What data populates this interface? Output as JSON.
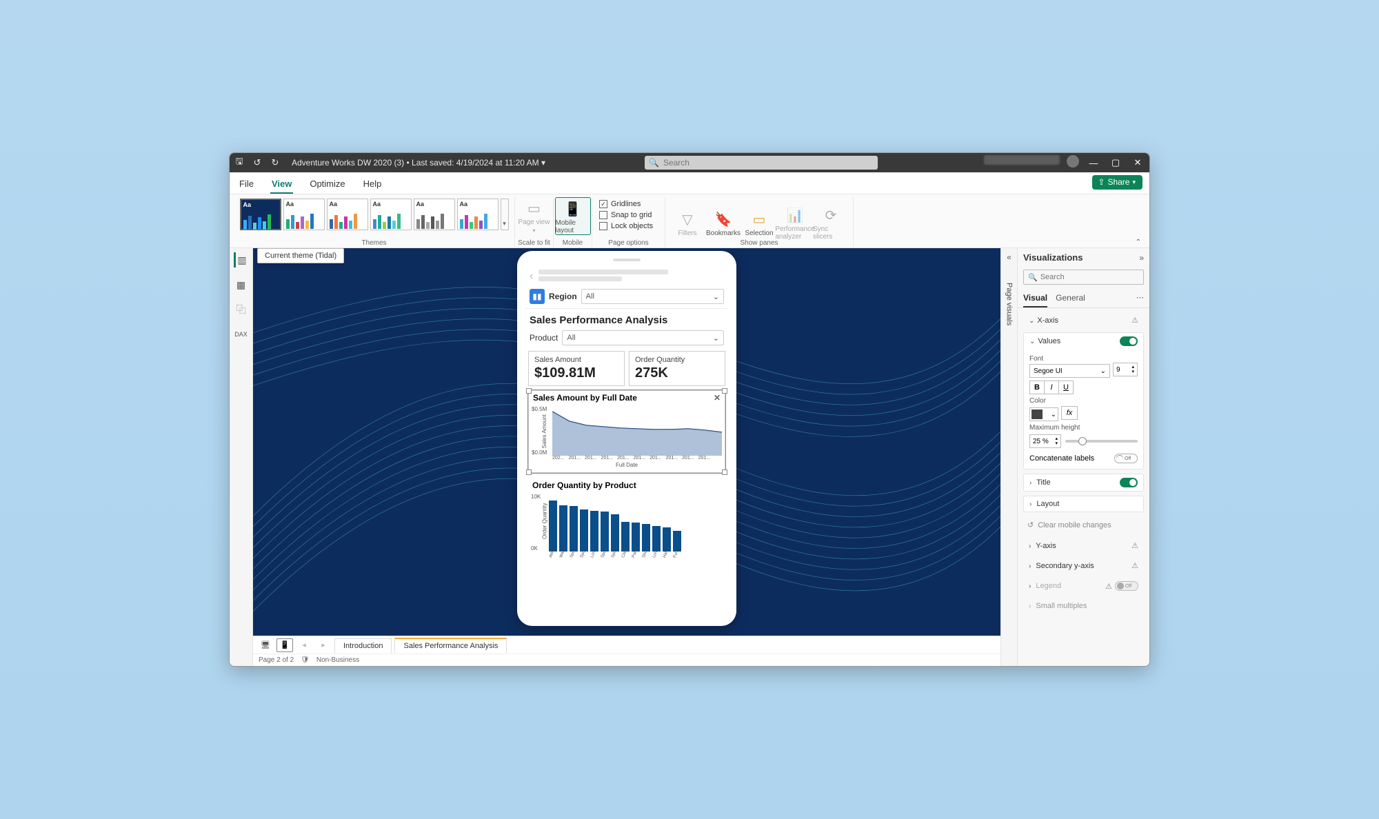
{
  "titlebar": {
    "filename": "Adventure Works DW 2020 (3)",
    "saved": "Last saved: 4/19/2024 at 11:20 AM",
    "search_placeholder": "Search"
  },
  "menu": {
    "file": "File",
    "view": "View",
    "optimize": "Optimize",
    "help": "Help",
    "share": "Share"
  },
  "ribbon": {
    "themes_label": "Themes",
    "tooltip": "Current theme (Tidal)",
    "scale_group": "Scale to fit",
    "page_view": "Page view",
    "mobile_group": "Mobile",
    "mobile_layout": "Mobile layout",
    "pageopt_group": "Page options",
    "gridlines": "Gridlines",
    "snap": "Snap to grid",
    "lock": "Lock objects",
    "showpanes_group": "Show panes",
    "filters": "Filters",
    "bookmarks": "Bookmarks",
    "selection": "Selection",
    "perf": "Performance analyzer",
    "sync": "Sync slicers"
  },
  "phone": {
    "region_label": "Region",
    "region_value": "All",
    "title": "Sales Performance Analysis",
    "product_label": "Product",
    "product_value": "All",
    "card1_label": "Sales Amount",
    "card1_value": "$109.81M",
    "card2_label": "Order Quantity",
    "card2_value": "275K",
    "chart1_title": "Sales Amount by Full Date",
    "chart1_xlabel": "Full Date",
    "chart1_ylabel": "Sales Amount",
    "chart2_title": "Order Quantity by Product",
    "chart2_ylabel": "Order Quantity"
  },
  "chart_data": [
    {
      "type": "area",
      "title": "Sales Amount by Full Date",
      "xlabel": "Full Date",
      "ylabel": "Sales Amount",
      "yticks": [
        "$0.5M",
        "$0.0M"
      ],
      "categories": [
        "202...",
        "201...",
        "201...",
        "201...",
        "201...",
        "201...",
        "201...",
        "201...",
        "201...",
        "201..."
      ],
      "values": [
        0.55,
        0.44,
        0.4,
        0.38,
        0.36,
        0.35,
        0.34,
        0.33,
        0.32,
        0.3
      ],
      "ylim": [
        0,
        0.6
      ]
    },
    {
      "type": "bar",
      "title": "Order Quantity by Product",
      "ylabel": "Order Quantity",
      "yticks": [
        "10K",
        "0K"
      ],
      "categories": [
        "AW...",
        "Wat...",
        "Spo...",
        "Spo...",
        "Lon...",
        "Spo...",
        "Spo...",
        "Clas...",
        "Patc...",
        "Sho...",
        "Lon...",
        "Hal...",
        "Ful..."
      ],
      "values": [
        9.2,
        8.4,
        8.2,
        7.6,
        7.4,
        7.2,
        6.8,
        5.4,
        5.2,
        5.0,
        4.6,
        4.4,
        3.8
      ],
      "ylim": [
        0,
        10
      ]
    }
  ],
  "pages": {
    "tab1": "Introduction",
    "tab2": "Sales Performance Analysis",
    "status_page": "Page 2 of 2",
    "status_class": "Non-Business"
  },
  "vizpane": {
    "title": "Visualizations",
    "collapsed_label": "Page visuals",
    "search_placeholder": "Search",
    "tab_visual": "Visual",
    "tab_general": "General",
    "xaxis": "X-axis",
    "values": "Values",
    "font_label": "Font",
    "font_value": "Segoe UI",
    "font_size": "9",
    "color_label": "Color",
    "maxheight_label": "Maximum height",
    "maxheight_value": "25 %",
    "concat_label": "Concatenate labels",
    "concat_toggle": "Off",
    "title_sec": "Title",
    "layout_sec": "Layout",
    "clear_mobile": "Clear mobile changes",
    "yaxis": "Y-axis",
    "sec_yaxis": "Secondary y-axis",
    "legend": "Legend",
    "legend_toggle": "Off",
    "small_mult": "Small multiples"
  }
}
